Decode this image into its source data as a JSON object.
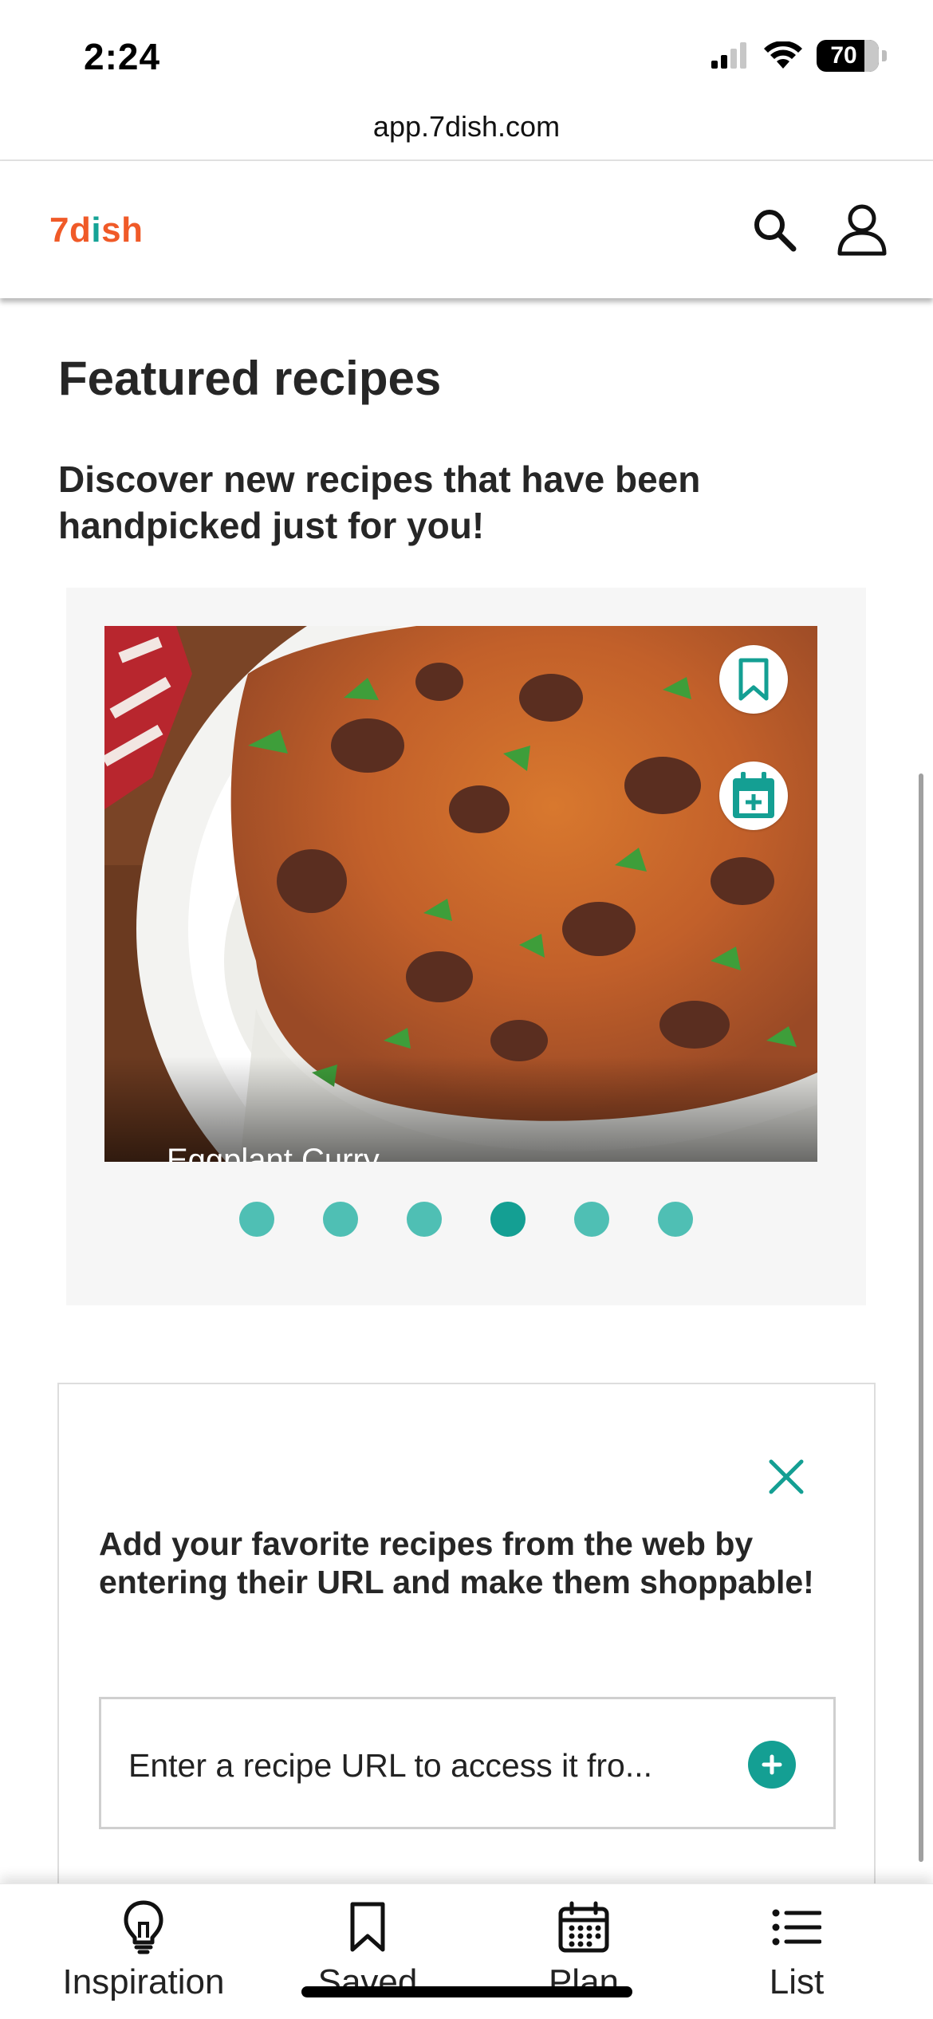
{
  "status_bar": {
    "time": "2:24",
    "battery": "70",
    "icons": [
      "signal-icon",
      "wifi-icon",
      "battery-icon"
    ]
  },
  "browser": {
    "url": "app.7dish.com"
  },
  "header": {
    "logo_prefix": "7d",
    "logo_accent": "i",
    "logo_suffix": "sh",
    "icons": [
      "search-icon",
      "profile-icon"
    ]
  },
  "featured": {
    "title": "Featured recipes",
    "subtitle": "Discover new recipes that have been handpicked just for you!",
    "slide": {
      "title": "Eggplant Curry",
      "icons": [
        "bookmark-icon",
        "calendar-add-icon"
      ]
    },
    "dots": {
      "count": 6,
      "active_index": 3
    }
  },
  "url_card": {
    "text": "Add your favorite recipes from the web by entering their URL and make them shoppable!",
    "placeholder": "Enter a recipe URL to access it fro...",
    "icons": [
      "close-icon",
      "add-icon"
    ]
  },
  "bottom_nav": {
    "items": [
      {
        "label": "Inspiration",
        "icon": "lightbulb-icon"
      },
      {
        "label": "Saved",
        "icon": "bookmark-icon"
      },
      {
        "label": "Plan",
        "icon": "calendar-icon"
      },
      {
        "label": "List",
        "icon": "list-icon"
      }
    ]
  },
  "colors": {
    "brand_orange": "#f05a28",
    "brand_teal": "#149f93",
    "dot_teal": "#4fbfb4",
    "carousel_bg": "#f6f6f6"
  }
}
